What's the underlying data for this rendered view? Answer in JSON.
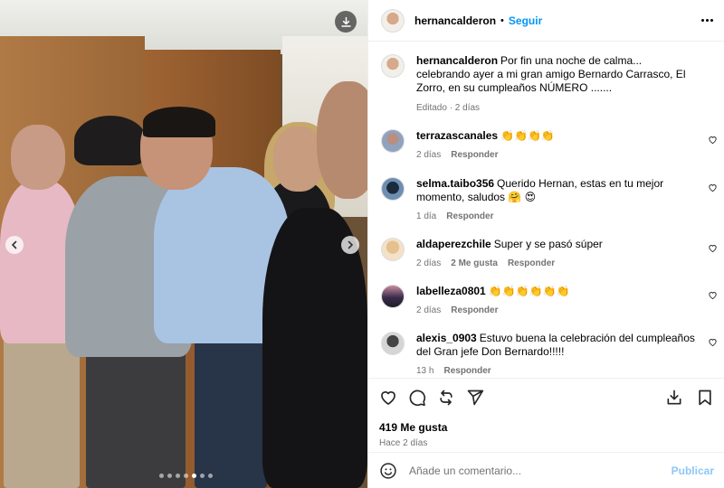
{
  "post": {
    "author": "hernancalderon",
    "separator": "•",
    "follow_label": "Seguir",
    "caption": "Por fin una noche de calma... celebrando ayer a mi gran amigo Bernardo Carrasco, El Zorro, en su cumpleaños NÚMERO .......",
    "caption_meta": "Editado · 2 días",
    "carousel": {
      "total_slides": 7,
      "active_slide": 5
    }
  },
  "comments": [
    {
      "user": "terrazascanales",
      "text": "👏👏👏👏",
      "time": "2 días",
      "likes": "",
      "reply": "Responder"
    },
    {
      "user": "selma.taibo356",
      "text": "Querido Hernan, estas en tu mejor momento, saludos 🤗 😍",
      "time": "1 día",
      "likes": "",
      "reply": "Responder"
    },
    {
      "user": "aldaperezchile",
      "text": "Super y se pasó súper",
      "time": "2 días",
      "likes": "2 Me gusta",
      "reply": "Responder"
    },
    {
      "user": "labelleza0801",
      "text": "👏👏👏👏👏👏",
      "time": "2 días",
      "likes": "",
      "reply": "Responder"
    },
    {
      "user": "alexis_0903",
      "text": "Estuvo buena la celebración del cumpleaños del Gran jefe Don Bernardo!!!!!",
      "time": "13 h",
      "likes": "",
      "reply": "Responder"
    }
  ],
  "actions": {
    "likes_count": "419 Me gusta",
    "posted_ago": "Hace 2 días"
  },
  "composer": {
    "placeholder": "Añade un comentario...",
    "post_label": "Publicar"
  },
  "colors": {
    "accent": "#0095f6",
    "muted": "#737373",
    "post_disabled": "#8cc8f9"
  }
}
